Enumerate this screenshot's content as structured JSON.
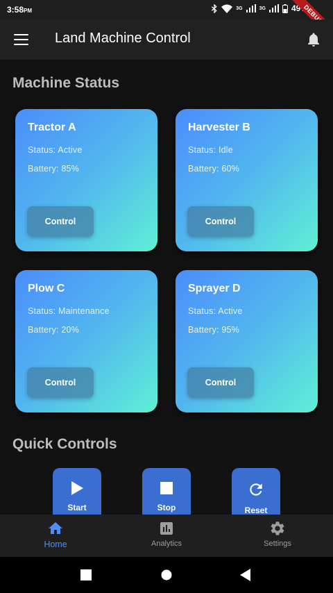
{
  "status_bar": {
    "time": "3:58",
    "ampm": "PM",
    "battery": "49%",
    "network": "3G",
    "debug": "DEBUG"
  },
  "app_bar": {
    "title": "Land Machine Control",
    "menu_icon": "menu-icon",
    "notify_icon": "bell-icon"
  },
  "machine_status": {
    "heading": "Machine Status",
    "machines": [
      {
        "name": "Tractor A",
        "status": "Status: Active",
        "battery": "Battery: 85%",
        "button": "Control"
      },
      {
        "name": "Harvester B",
        "status": "Status: Idle",
        "battery": "Battery: 60%",
        "button": "Control"
      },
      {
        "name": "Plow C",
        "status": "Status: Maintenance",
        "battery": "Battery: 20%",
        "button": "Control"
      },
      {
        "name": "Sprayer D",
        "status": "Status: Active",
        "battery": "Battery: 95%",
        "button": "Control"
      }
    ]
  },
  "quick_controls": {
    "heading": "Quick Controls",
    "buttons": [
      {
        "label": "Start",
        "icon": "play-icon"
      },
      {
        "label": "Stop",
        "icon": "stop-icon"
      },
      {
        "label": "Reset",
        "icon": "refresh-icon"
      }
    ]
  },
  "bottom_nav": {
    "items": [
      {
        "label": "Home",
        "icon": "home-icon",
        "active": true
      },
      {
        "label": "Analytics",
        "icon": "analytics-icon",
        "active": false
      },
      {
        "label": "Settings",
        "icon": "settings-icon",
        "active": false
      }
    ]
  },
  "colors": {
    "accent": "#4f8df0",
    "background": "#121212",
    "app_bar": "#212121",
    "quick_button": "#3a6fd1"
  }
}
